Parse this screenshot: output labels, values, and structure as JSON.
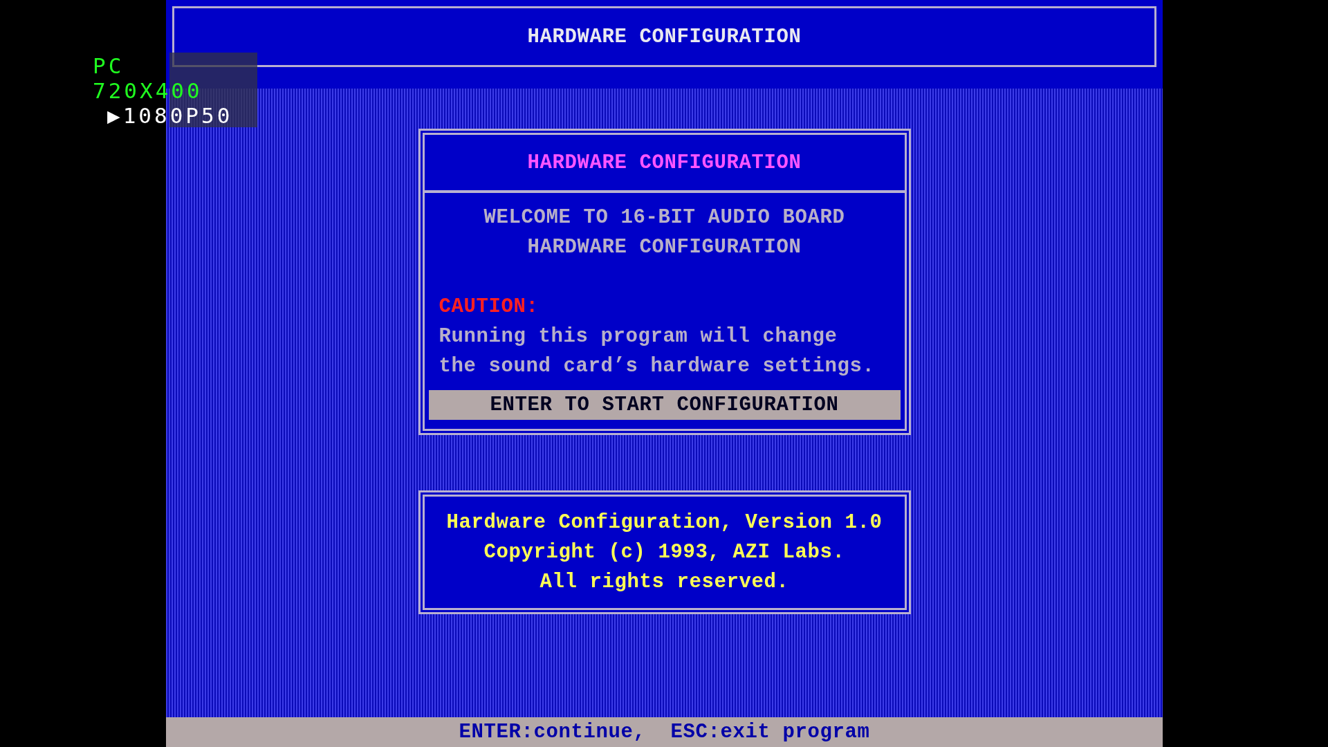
{
  "osd": {
    "lines": [
      "PC",
      "720X400",
      "▶1080P50"
    ]
  },
  "header": {
    "title": "HARDWARE CONFIGURATION"
  },
  "dialog": {
    "title": "HARDWARE CONFIGURATION",
    "welcome": [
      "WELCOME TO 16-BIT AUDIO BOARD",
      "HARDWARE CONFIGURATION"
    ],
    "caution_label": "CAUTION:",
    "caution_text": [
      "Running this program will change",
      "the sound card’s hardware settings."
    ],
    "button": {
      "label": "ENTER TO START CONFIGURATION",
      "selected": true
    }
  },
  "about": {
    "lines": [
      "Hardware Configuration, Version 1.0",
      "Copyright (c) 1993, AZI Labs.",
      "All rights reserved."
    ]
  },
  "status_bar": {
    "text": "ENTER:continue,  ESC:exit program"
  }
}
